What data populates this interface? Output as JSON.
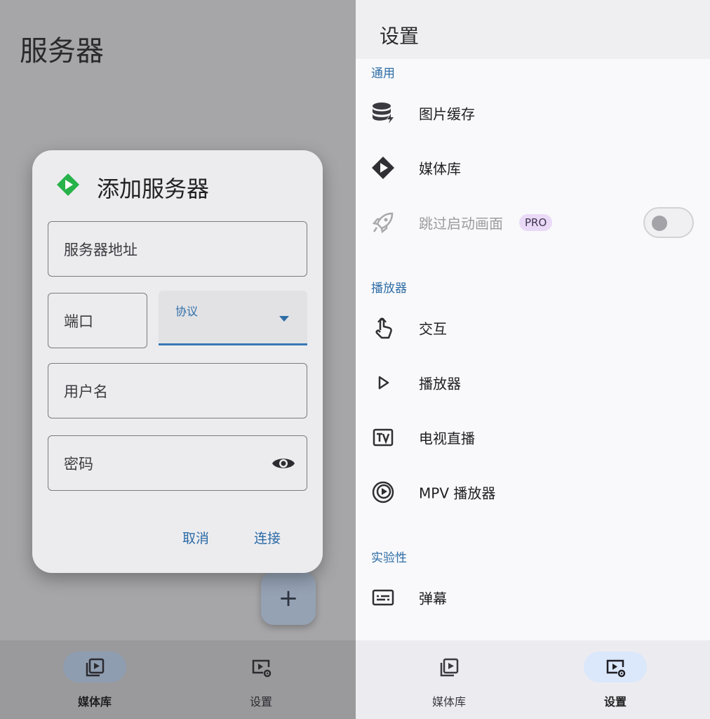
{
  "left": {
    "page_title": "服务器",
    "fab_label": "+",
    "dialog": {
      "title": "添加服务器",
      "address_label": "服务器地址",
      "port_label": "端口",
      "protocol_label": "协议",
      "username_label": "用户名",
      "password_label": "密码",
      "cancel": "取消",
      "connect": "连接"
    },
    "nav": [
      {
        "label": "媒体库",
        "active": true
      },
      {
        "label": "设置",
        "active": false
      }
    ]
  },
  "right": {
    "title": "设置",
    "sections": {
      "general": "通用",
      "player": "播放器",
      "experimental": "实验性"
    },
    "items": {
      "image_cache": "图片缓存",
      "media_library": "媒体库",
      "skip_splash": "跳过启动画面",
      "pro_badge": "PRO",
      "interaction": "交互",
      "player": "播放器",
      "live_tv": "电视直播",
      "mpv_player": "MPV 播放器",
      "danmaku": "弹幕"
    },
    "nav": [
      {
        "label": "媒体库",
        "active": false
      },
      {
        "label": "设置",
        "active": true
      }
    ]
  },
  "colors": {
    "accent": "#2f6ea6",
    "brand_green": "#27b24a",
    "pro_badge_bg": "#ead9f7",
    "nav_active_pill": "#dbe7fb"
  }
}
